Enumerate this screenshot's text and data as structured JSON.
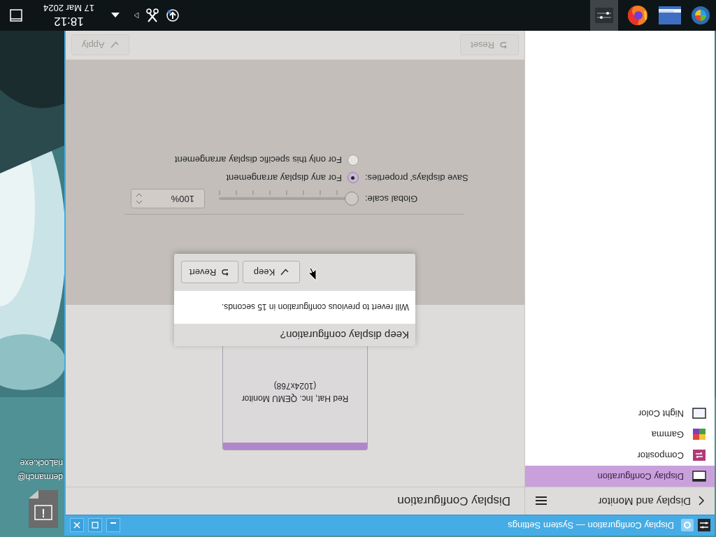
{
  "taskbar": {
    "clock": {
      "time": "18:12",
      "date": "17 Mar 2024"
    }
  },
  "desktop": {
    "icon_labels": [
      "dermanch@",
      "riaLock.exe"
    ]
  },
  "window": {
    "title": "Display Configuration — System Settings"
  },
  "sidebar": {
    "header": "Display and Monitor",
    "items": [
      {
        "label": "Display Configuration",
        "kind": "display",
        "selected": true
      },
      {
        "label": "Compositor",
        "kind": "compositor",
        "selected": false
      },
      {
        "label": "Gamma",
        "kind": "gamma",
        "selected": false
      },
      {
        "label": "Night Color",
        "kind": "night",
        "selected": false
      }
    ]
  },
  "page": {
    "title": "Display Configuration",
    "monitor": {
      "name": "Red Hat, Inc. QEMU Monitor",
      "resolution": "(1024x768)"
    },
    "global_scale": {
      "label": "Global scale:",
      "level": 0,
      "value": "100%"
    },
    "save_properties": {
      "label": "Save displays' properties:",
      "options": [
        {
          "label": "For any display arrangement",
          "selected": true
        },
        {
          "label": "For only this specific display arrangement",
          "selected": false
        }
      ]
    },
    "buttons": [
      {
        "label": "Reset",
        "kind": "undo",
        "disabled": true
      },
      {
        "label": "Apply",
        "kind": "check",
        "disabled": true
      }
    ]
  },
  "dialog": {
    "title": "Keep display configuration?",
    "message": "Will revert to previous configuration in 15 seconds.",
    "buttons": [
      {
        "label": "Keep",
        "kind": "check"
      },
      {
        "label": "Revert",
        "kind": "undo"
      }
    ]
  }
}
